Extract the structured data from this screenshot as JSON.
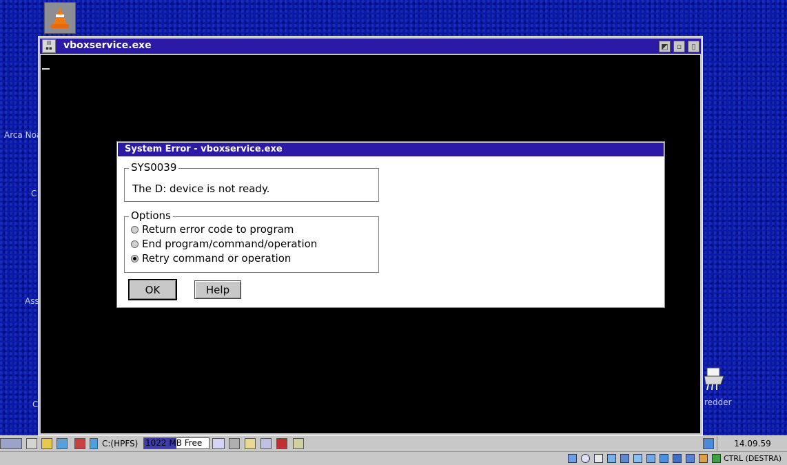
{
  "desktop": {
    "side_labels": [
      "Arca Noa",
      "C",
      "Ass",
      "C"
    ],
    "shredder_label": "redder"
  },
  "window": {
    "title": "vboxservice.exe"
  },
  "dialog": {
    "title": "System Error - vboxservice.exe",
    "error_code": "SYS0039",
    "message": "The D: device is not ready.",
    "options_label": "Options",
    "options": [
      {
        "label": "Return error code to program",
        "selected": false
      },
      {
        "label": "End program/command/operation",
        "selected": false
      },
      {
        "label": "Retry command or operation",
        "selected": true
      }
    ],
    "ok_label": "OK",
    "help_label": "Help"
  },
  "taskbar": {
    "drive_label": "C:(HPFS)",
    "free_label": "1022 MB Free",
    "free_fraction": 0.5,
    "clock": "14.09.59",
    "keyboard_status": "CTRL (DESTRA)"
  },
  "colors": {
    "desktop_bg": "#0a1aa8",
    "titlebar": "#2a1aa5",
    "console_bg": "#000000",
    "chrome": "#c8c8c8"
  }
}
